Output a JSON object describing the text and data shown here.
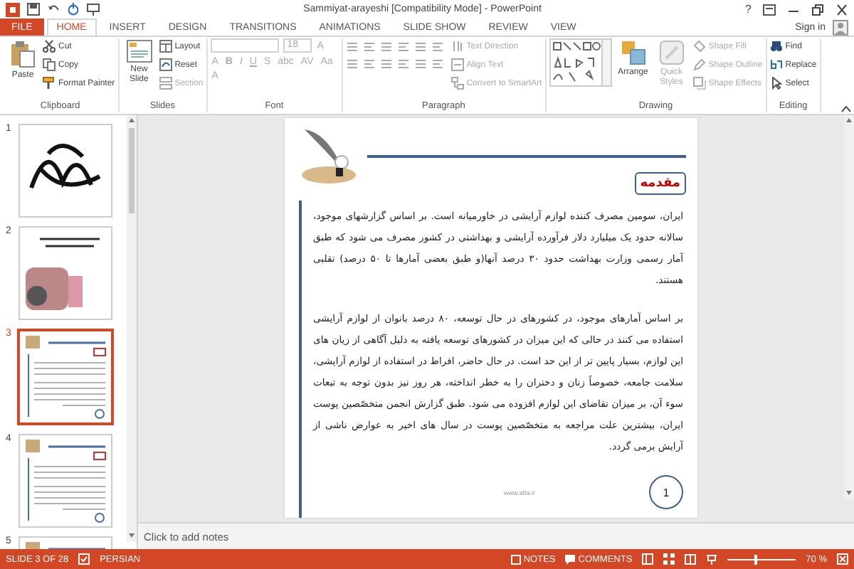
{
  "window": {
    "title": "Sammiyat-arayeshi [Compatibility Mode] - PowerPoint",
    "help": "?"
  },
  "tabs": [
    {
      "label": "FILE",
      "selected": false,
      "kind": "file"
    },
    {
      "label": "HOME",
      "selected": true,
      "kind": "tab"
    },
    {
      "label": "INSERT",
      "selected": false,
      "kind": "tab"
    },
    {
      "label": "DESIGN",
      "selected": false,
      "kind": "tab"
    },
    {
      "label": "TRANSITIONS",
      "selected": false,
      "kind": "tab"
    },
    {
      "label": "ANIMATIONS",
      "selected": false,
      "kind": "tab"
    },
    {
      "label": "SLIDE SHOW",
      "selected": false,
      "kind": "tab"
    },
    {
      "label": "REVIEW",
      "selected": false,
      "kind": "tab"
    },
    {
      "label": "VIEW",
      "selected": false,
      "kind": "tab"
    }
  ],
  "sign_in": "Sign in",
  "ribbon": {
    "groups": [
      {
        "label": "Clipboard",
        "items": [
          {
            "kind": "large",
            "label": "Paste",
            "disabled": false
          },
          {
            "kind": "small",
            "label": "Cut",
            "disabled": false
          },
          {
            "kind": "small",
            "label": "Copy",
            "disabled": false
          },
          {
            "kind": "small",
            "label": "Format Painter",
            "disabled": false
          }
        ]
      },
      {
        "label": "Slides",
        "items": [
          {
            "kind": "large",
            "label": "New Slide",
            "disabled": false
          },
          {
            "kind": "small",
            "label": "Layout",
            "disabled": false
          },
          {
            "kind": "small",
            "label": "Reset",
            "disabled": false
          },
          {
            "kind": "small",
            "label": "Section",
            "disabled": true
          }
        ]
      },
      {
        "label": "Font",
        "items": [
          {
            "kind": "field",
            "disabled": true
          },
          {
            "kind": "field",
            "value": "18",
            "disabled": true
          },
          {
            "kind": "glyph",
            "label": "A",
            "disabled": true
          },
          {
            "kind": "glyph",
            "label": "A",
            "disabled": true
          },
          {
            "kind": "glyph",
            "label": "B",
            "disabled": true
          },
          {
            "kind": "glyph",
            "label": "I",
            "disabled": true
          },
          {
            "kind": "glyph",
            "label": "U",
            "disabled": true
          },
          {
            "kind": "glyph",
            "label": "S",
            "disabled": true
          },
          {
            "kind": "glyph",
            "label": "abc",
            "disabled": true
          },
          {
            "kind": "glyph",
            "label": "AV",
            "disabled": true
          },
          {
            "kind": "glyph",
            "label": "Aa",
            "disabled": true
          },
          {
            "kind": "glyph",
            "label": "A",
            "disabled": true
          }
        ]
      },
      {
        "label": "Paragraph",
        "items": [
          {
            "kind": "icons"
          },
          {
            "kind": "small",
            "label": "Text Direction",
            "disabled": true
          },
          {
            "kind": "small",
            "label": "Align Text",
            "disabled": true
          },
          {
            "kind": "small",
            "label": "Convert to SmartArt",
            "disabled": true
          }
        ]
      },
      {
        "label": "Drawing",
        "items": [
          {
            "kind": "gallery"
          },
          {
            "kind": "large",
            "label": "Arrange",
            "disabled": false
          },
          {
            "kind": "large",
            "label": "Quick Styles",
            "disabled": true
          },
          {
            "kind": "small",
            "label": "Shape Fill",
            "disabled": true
          },
          {
            "kind": "small",
            "label": "Shape Outline",
            "disabled": true
          },
          {
            "kind": "small",
            "label": "Shape Effects",
            "disabled": true
          }
        ]
      },
      {
        "label": "Editing",
        "items": [
          {
            "kind": "small",
            "label": "Find",
            "disabled": false
          },
          {
            "kind": "small",
            "label": "Replace",
            "disabled": false
          },
          {
            "kind": "small",
            "label": "Select",
            "disabled": false
          }
        ]
      }
    ]
  },
  "slides": [
    {
      "number": "1",
      "selected": false
    },
    {
      "number": "2",
      "selected": false
    },
    {
      "number": "3",
      "selected": true
    },
    {
      "number": "4",
      "selected": false
    },
    {
      "number": "5",
      "selected": false
    }
  ],
  "slide": {
    "title": "مقدمه",
    "paragraphs": [
      "ایران، سومین مصرف کننده لوازم آرایشی در خاورمیانه است. بر اساس گزارشهای موجود، سالانه حدود یک میلیارد دلار فرآورده آرایشی و بهداشتی در کشور مصرف می شود که طبق آمار رسمی وزارت بهداشت حدود ۳۰ درصد آنها(و طبق بعضی آمارها تا ۵۰ درصد) تقلبی هستند.",
      "بر اساس آمارهای موجود، در کشورهای در حال توسعه، ۸۰ درصد بانوان از لوازم آرایشی استفاده می کنند در حالی که این میزان در کشورهای توسعه یافته به دلیل آگاهی از زیان های این لوازم، بسیار پایین تر از این حد است. در حال حاضر، افراط در استفاده از لوازم آرایشی، سلامت جامعه، خصوصاً زنان و دختران را به خطر انداخته، هر روز نیز بدون توجه به تبعات سوء آن، بر میزان تقاضای این لوازم افزوده می شود. طبق گزارش انجمن متخصّصین پوست ایران، بیشترین علت مراجعه به متخصّصین پوست در سال های اخیر به عوارض ناشی از آرایش برمی گردد."
    ],
    "footer": "www.afta.ir",
    "page_number": "1"
  },
  "notes_placeholder": "Click to add notes",
  "status_bar": {
    "slide": "SLIDE 3 OF 28",
    "language": "PERSIAN",
    "notes": "NOTES",
    "comments": "COMMENTS",
    "zoom": {
      "level": 0.4,
      "reading": "70 %"
    }
  }
}
